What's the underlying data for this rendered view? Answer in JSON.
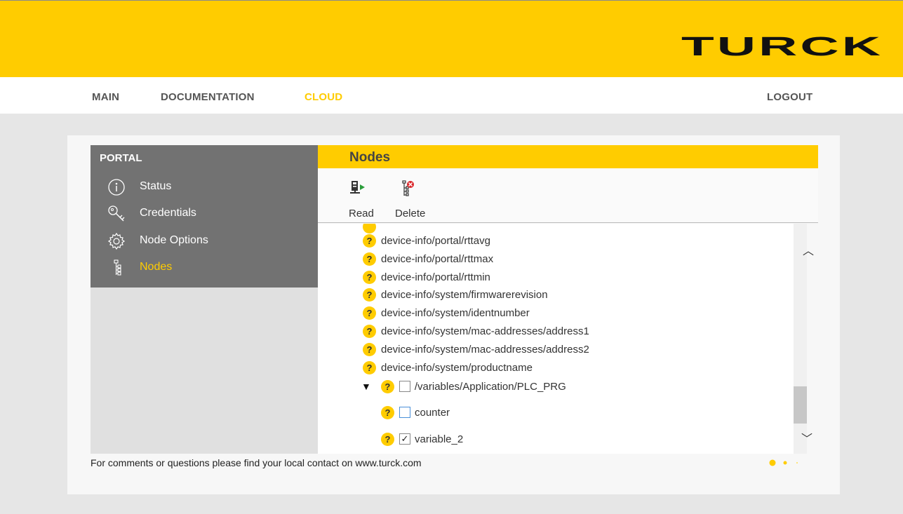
{
  "brand": {
    "logo_text": "TURCK",
    "accent": "#ffcc00",
    "gray": "#727272"
  },
  "topnav": {
    "main": "MAIN",
    "documentation": "DOCUMENTATION",
    "cloud": "CLOUD",
    "logout": "LOGOUT"
  },
  "sidebar": {
    "title": "PORTAL",
    "items": [
      {
        "label": "Status",
        "icon": "info-icon"
      },
      {
        "label": "Credentials",
        "icon": "key-icon"
      },
      {
        "label": "Node Options",
        "icon": "gear-icon"
      },
      {
        "label": "Nodes",
        "icon": "tree-icon",
        "active": true
      }
    ]
  },
  "main": {
    "title": "Nodes",
    "toolbar": {
      "read_label": "Read",
      "delete_label": "Delete"
    },
    "tree": {
      "rows": [
        "device-info/portal/rttavg",
        "device-info/portal/rttmax",
        "device-info/portal/rttmin",
        "device-info/system/firmwarerevision",
        "device-info/system/identnumber",
        "device-info/system/mac-addresses/address1",
        "device-info/system/mac-addresses/address2",
        "device-info/system/productname"
      ],
      "folder_label": "/variables/Application/PLC_PRG",
      "child1_label": "counter",
      "child2_label": "variable_2",
      "child2_checked": true,
      "badge": "?"
    }
  },
  "footer": {
    "text": "For comments or questions please find your local contact on www.turck.com"
  }
}
